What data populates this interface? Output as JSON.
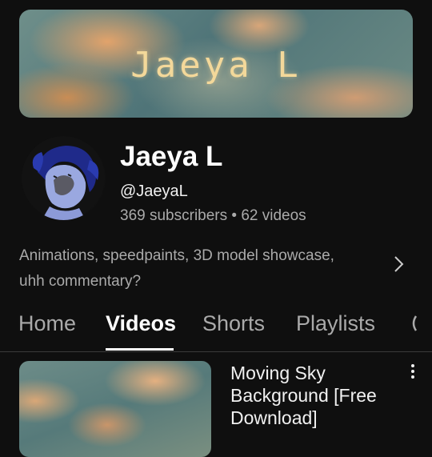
{
  "banner": {
    "title": "Jaeya L"
  },
  "channel": {
    "name": "Jaeya L",
    "handle": "@JaeyaL",
    "subscribers": "369 subscribers",
    "separator": "•",
    "videos": "62 videos",
    "description_line1": "Animations, speedpaints, 3D model showcase,",
    "description_line2": "uhh commentary?"
  },
  "tabs": [
    {
      "label": "Home"
    },
    {
      "label": "Videos"
    },
    {
      "label": "Shorts"
    },
    {
      "label": "Playlists"
    }
  ],
  "active_tab": "Videos",
  "video": {
    "title": "Moving Sky Background [Free Download]"
  },
  "colors": {
    "background": "#0f0f0f",
    "primary_text": "#f1f1f1",
    "secondary_text": "#aaaaaa",
    "banner_text": "#f3d89a"
  }
}
